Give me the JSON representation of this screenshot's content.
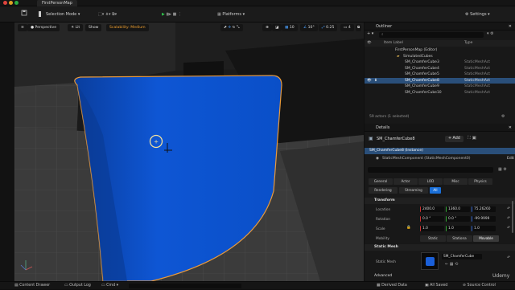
{
  "window": {
    "tab_label": "FirstPersonMap"
  },
  "toolbar": {
    "selection_mode": "Selection Mode",
    "platforms": "Platforms",
    "settings": "Settings"
  },
  "viewport": {
    "perspective": "Perspective",
    "lit": "Lit",
    "show": "Show",
    "scalability": "Scalability: Medium",
    "grid_snap": "10",
    "rot_snap": "10°",
    "scale_snap": "0.25",
    "cam_speed": "4"
  },
  "outliner": {
    "title": "Outliner",
    "col_label": "Item Label",
    "col_type": "Type",
    "items": [
      {
        "label": "FirstPersonMap (Editor)",
        "type": ""
      },
      {
        "label": "SimulatedCubes",
        "type": ""
      },
      {
        "label": "SM_ChamferCube3",
        "type": "StaticMeshAct"
      },
      {
        "label": "SM_ChamferCube4",
        "type": "StaticMeshAct"
      },
      {
        "label": "SM_ChamferCube5",
        "type": "StaticMeshAct"
      },
      {
        "label": "SM_ChamferCube8",
        "type": "StaticMeshAct"
      },
      {
        "label": "SM_ChamferCube9",
        "type": "StaticMeshAct"
      },
      {
        "label": "SM_ChamferCube10",
        "type": "StaticMeshAct"
      }
    ],
    "footer": "59 actors (1 selected)"
  },
  "details": {
    "title": "Details",
    "actor_name": "SM_ChamferCube8",
    "add_label": "+ Add",
    "instance_row": "SM_ChamferCube8 (Instance)",
    "component_row": "StaticMeshComponent (StaticMeshComponent0)",
    "edit_label": "Edit",
    "tabs_row1": [
      "General",
      "Actor",
      "LOD",
      "Misc",
      "Physics"
    ],
    "tabs_row2": [
      "Rendering",
      "Streaming",
      "All"
    ],
    "transform": {
      "section": "Transform",
      "location_label": "Location",
      "location": [
        "2400.0",
        "1360.0",
        "75.26260"
      ],
      "rotation_label": "Rotation",
      "rotation": [
        "0.0 °",
        "0.0 °",
        "-99.9999"
      ],
      "scale_label": "Scale",
      "scale": [
        "1.0",
        "1.0",
        "1.0"
      ],
      "mobility_label": "Mobility",
      "mobility": [
        "Static",
        "Stationa",
        "Movable"
      ]
    },
    "static_mesh": {
      "section": "Static Mesh",
      "label": "Static Mesh",
      "asset": "SM_ChamferCube"
    },
    "advanced": "Advanced"
  },
  "statusbar": {
    "content_drawer": "Content Drawer",
    "output_log": "Output Log",
    "cmd": "Cmd",
    "derived_data": "Derived Data",
    "all_saved": "All Saved",
    "source_control": "Source Control"
  },
  "watermark": "Udemy",
  "colors": {
    "cube": "#0a52d6",
    "accent": "#1a6fd8",
    "selection": "#2a4f7a"
  }
}
